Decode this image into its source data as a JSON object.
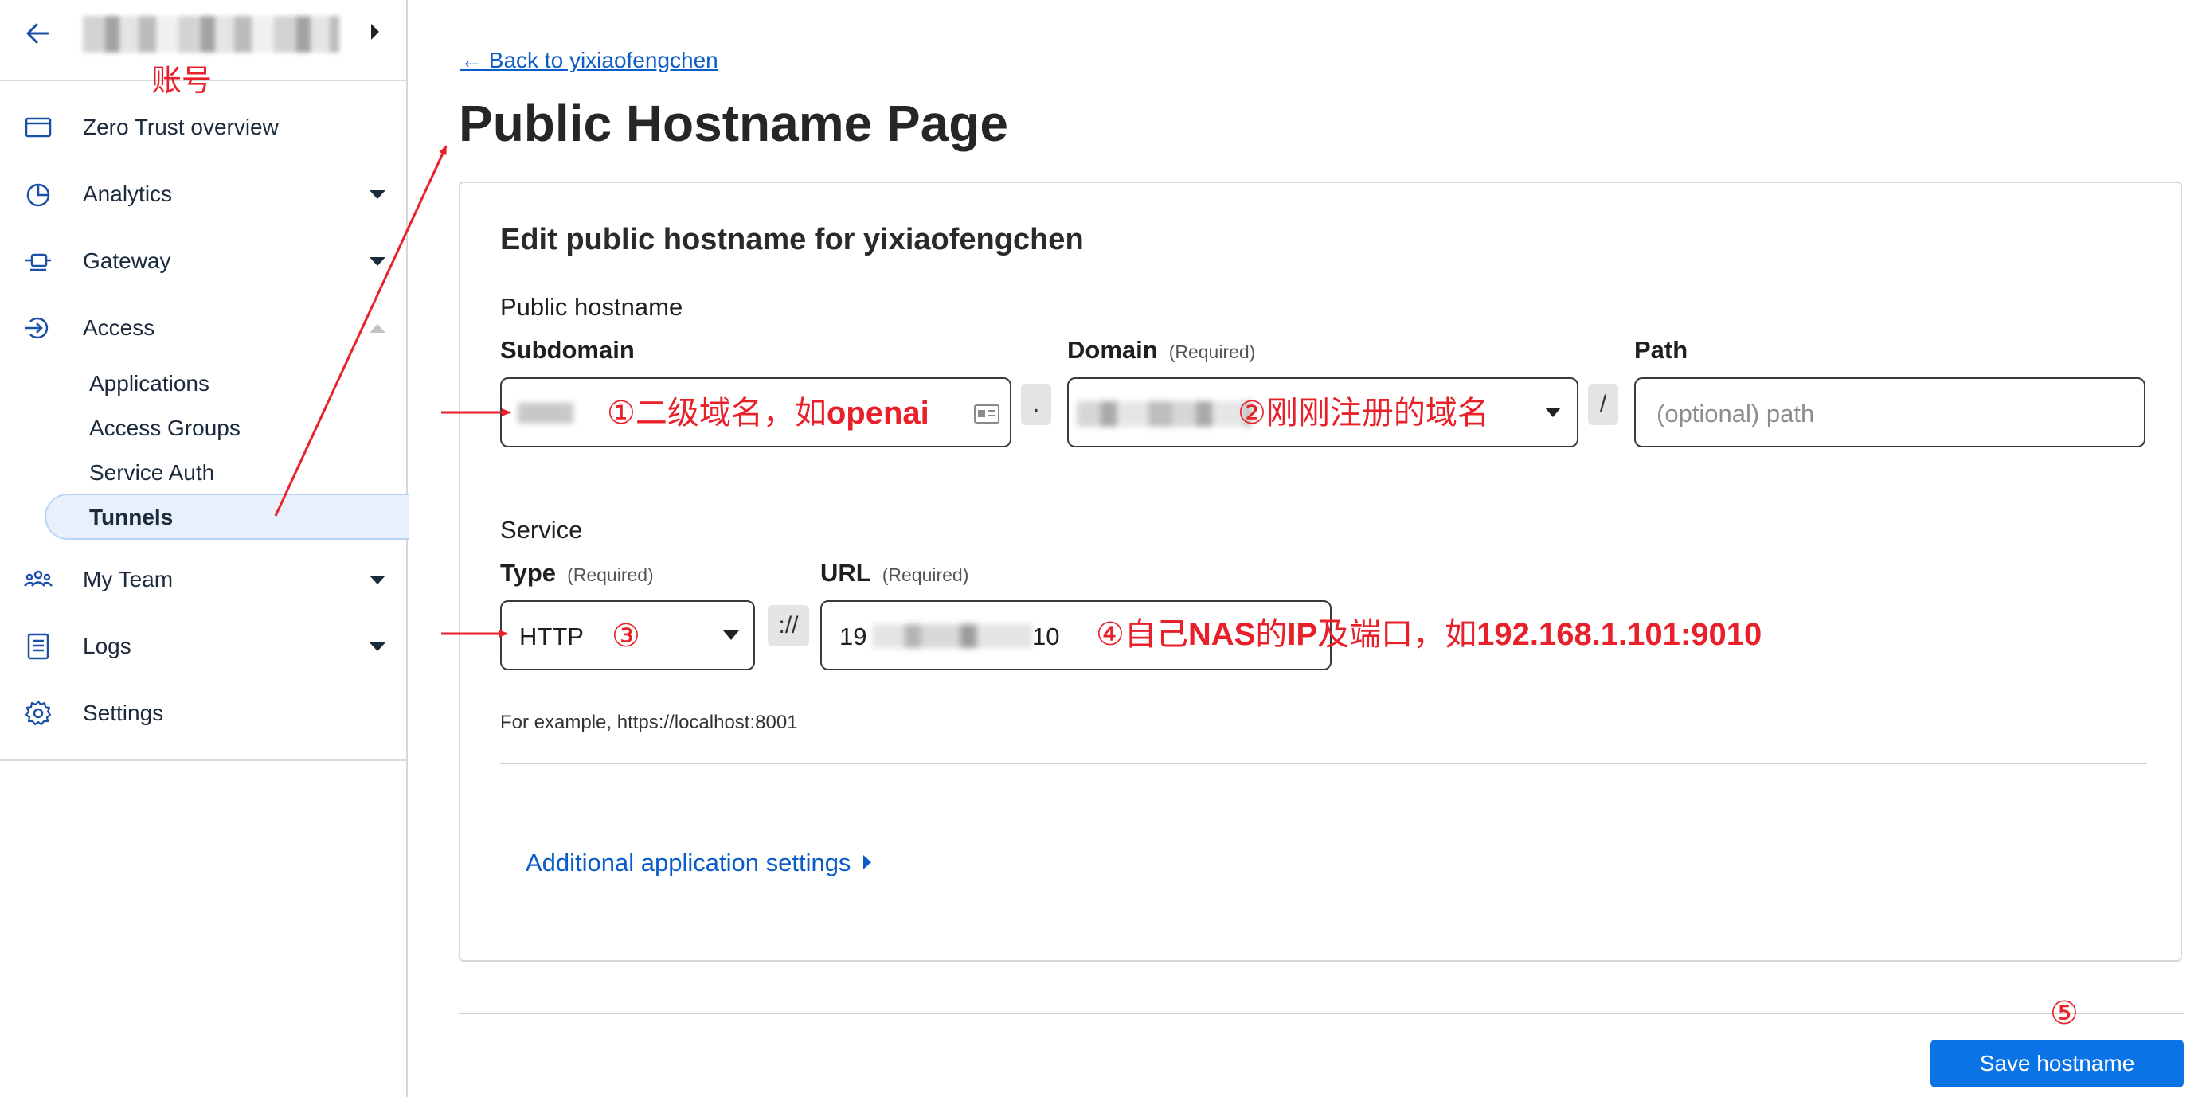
{
  "sidebar": {
    "account_annotation": "账号",
    "items": [
      {
        "label": "Zero Trust overview"
      },
      {
        "label": "Analytics"
      },
      {
        "label": "Gateway"
      },
      {
        "label": "Access"
      },
      {
        "label": "My Team"
      },
      {
        "label": "Logs"
      },
      {
        "label": "Settings"
      }
    ],
    "access_sub": [
      "Applications",
      "Access Groups",
      "Service Auth",
      "Tunnels"
    ]
  },
  "main": {
    "back_link": "← Back to yixiaofengchen",
    "page_title": "Public Hostname Page",
    "card_title": "Edit public hostname for yixiaofengchen",
    "public_hostname_label": "Public hostname",
    "subdomain_label": "Subdomain",
    "domain_label": "Domain",
    "domain_req": "(Required)",
    "path_label": "Path",
    "path_placeholder": "(optional) path",
    "dot_sep": ".",
    "slash_sep": "/",
    "service_label": "Service",
    "type_label": "Type",
    "type_req": "(Required)",
    "type_value": "HTTP",
    "proto_sep": "://",
    "url_label": "URL",
    "url_req": "(Required)",
    "url_value_start": "19",
    "url_value_end": "10",
    "hint": "For example, https://localhost:8001",
    "additional_settings": "Additional application settings",
    "save_button": "Save hostname"
  },
  "annotations": {
    "a1_prefix": "①二级域名，如",
    "a1_bold": "openai",
    "a2": "②刚刚注册的域名",
    "a3": "③",
    "a4_prefix": "④自己",
    "a4_bold1": "NAS",
    "a4_mid1": "的",
    "a4_bold2": "IP",
    "a4_mid2": "及端口，如",
    "a4_bold3": "192.168.1.101:9010",
    "a5": "⑤"
  },
  "colors": {
    "accent": "#0a73e6",
    "link": "#0a5cc9",
    "annotation": "#e8202a",
    "active_nav_bg": "#e8f1fb"
  }
}
